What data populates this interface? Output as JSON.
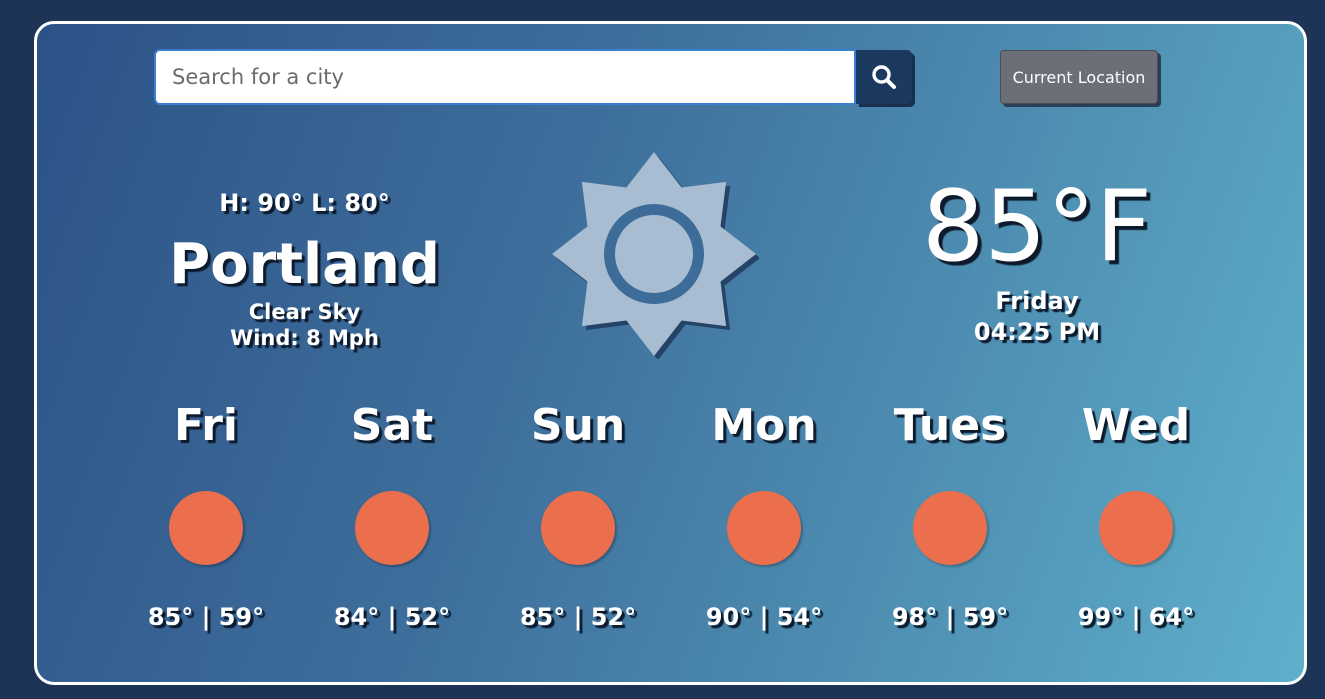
{
  "search": {
    "placeholder": "Search for a city"
  },
  "buttons": {
    "current_location": "Current Location"
  },
  "current": {
    "hilo": "H: 90°  L: 80°",
    "city": "Portland",
    "condition": "Clear Sky",
    "wind": "Wind: 8 Mph",
    "temperature": "85°F",
    "day": "Friday",
    "time": "04:25 PM",
    "icon": "sun-icon"
  },
  "forecast": [
    {
      "day": "Fri",
      "temps": "85° | 59°",
      "icon": "sun-circle-icon"
    },
    {
      "day": "Sat",
      "temps": "84° | 52°",
      "icon": "sun-circle-icon"
    },
    {
      "day": "Sun",
      "temps": "85° | 52°",
      "icon": "sun-circle-icon"
    },
    {
      "day": "Mon",
      "temps": "90° | 54°",
      "icon": "sun-circle-icon"
    },
    {
      "day": "Tues",
      "temps": "98° | 59°",
      "icon": "sun-circle-icon"
    },
    {
      "day": "Wed",
      "temps": "99° | 64°",
      "icon": "sun-circle-icon"
    }
  ],
  "colors": {
    "background": "#1d3456",
    "sun_icon": "#a8bdd2",
    "forecast_sun": "#ec6f4d",
    "search_button": "#1c3a60",
    "location_button": "#6c6f78"
  }
}
